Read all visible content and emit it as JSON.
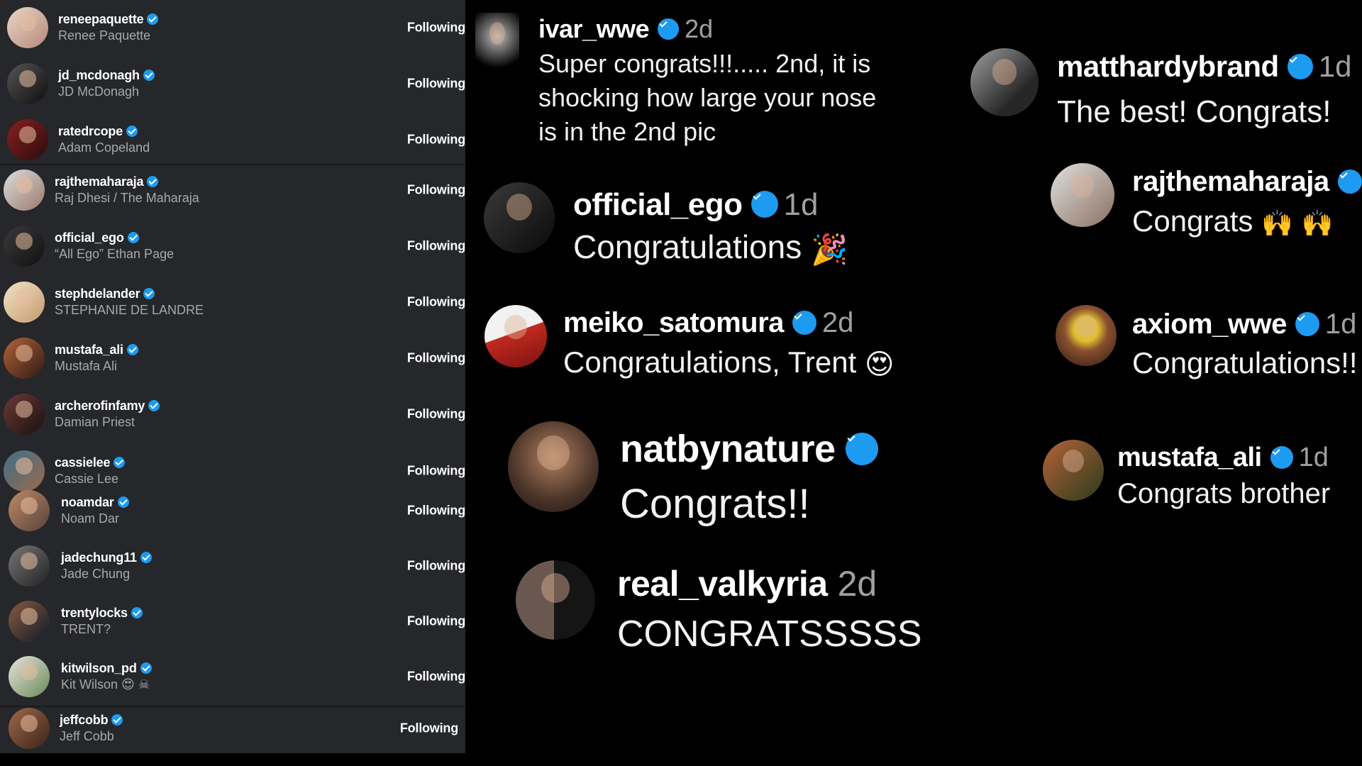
{
  "following": {
    "button_label": "Following",
    "accounts": [
      {
        "username": "reneepaquette",
        "name": "Renee Paquette"
      },
      {
        "username": "jd_mcdonagh",
        "name": "JD McDonagh"
      },
      {
        "username": "ratedrcope",
        "name": "Adam Copeland"
      },
      {
        "username": "rajthemaharaja",
        "name": "Raj Dhesi / The Maharaja"
      },
      {
        "username": "official_ego",
        "name": "“All Ego” Ethan Page"
      },
      {
        "username": "stephdelander",
        "name": "STEPHANIE DE LANDRE"
      },
      {
        "username": "mustafa_ali",
        "name": "Mustafa Ali"
      },
      {
        "username": "archerofinfamy",
        "name": "Damian Priest"
      },
      {
        "username": "cassielee",
        "name": "Cassie Lee"
      },
      {
        "username": "noamdar",
        "name": "Noam Dar"
      },
      {
        "username": "jadechung11",
        "name": "Jade Chung"
      },
      {
        "username": "trentylocks",
        "name": "TRENT?"
      },
      {
        "username": "kitwilson_pd",
        "name": "Kit Wilson"
      },
      {
        "username": "jeffcobb",
        "name": "Jeff Cobb"
      }
    ]
  },
  "comments": [
    {
      "username": "ivar_wwe",
      "time": "2d",
      "lines": [
        "Super congrats!!!..... 2nd, it is",
        "shocking how large your nose",
        "is in the 2nd pic"
      ]
    },
    {
      "username": "official_ego",
      "time": "1d",
      "lines": [
        "Congratulations"
      ],
      "emoji": "party-popper"
    },
    {
      "username": "meiko_satomura",
      "time": "2d",
      "lines": [
        "Congratulations, Trent"
      ],
      "emoji": "heart-eyes"
    },
    {
      "username": "natbynature",
      "time": "",
      "lines": [
        "Congrats!!"
      ]
    },
    {
      "username": "real_valkyria",
      "time": "2d",
      "lines": [
        "CONGRATSSSSS"
      ]
    },
    {
      "username": "matthardybrand",
      "time": "1d",
      "lines": [
        "The best! Congrats!"
      ]
    },
    {
      "username": "rajthemaharaja",
      "time": "",
      "lines": [
        "Congrats"
      ],
      "emoji": "raising-hands"
    },
    {
      "username": "axiom_wwe",
      "time": "1d",
      "lines": [
        "Congratulations!!"
      ]
    },
    {
      "username": "mustafa_ali",
      "time": "1d",
      "lines": [
        "Congrats brother"
      ]
    }
  ],
  "colors": {
    "panel": "#25272a",
    "verified": "#1d9bf0",
    "background": "#000000"
  }
}
